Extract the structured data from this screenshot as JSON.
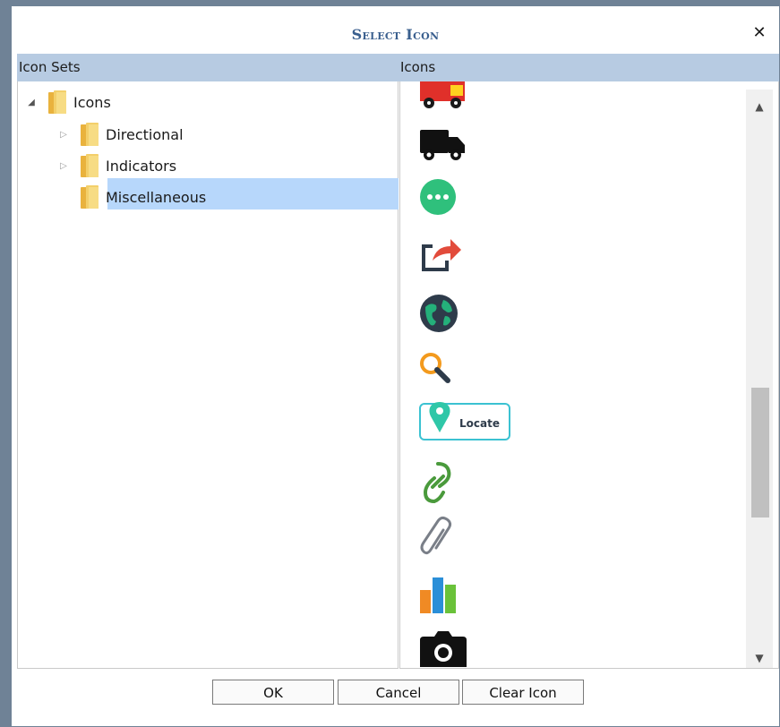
{
  "dialog": {
    "title": "Select Icon",
    "close_glyph": "✕"
  },
  "columns": {
    "left": "Icon Sets",
    "right": "Icons"
  },
  "tree": {
    "root": {
      "label": "Icons",
      "expanded": true
    },
    "children": [
      {
        "label": "Directional",
        "expanded": false
      },
      {
        "label": "Indicators",
        "expanded": false
      },
      {
        "label": "Miscellaneous",
        "selected": true
      }
    ]
  },
  "icons": [
    {
      "name": "fire-truck-icon"
    },
    {
      "name": "truck-icon"
    },
    {
      "name": "more-chat-icon"
    },
    {
      "name": "share-icon"
    },
    {
      "name": "globe-icon"
    },
    {
      "name": "search-icon"
    },
    {
      "name": "locate-icon",
      "label": "Locate"
    },
    {
      "name": "link-icon"
    },
    {
      "name": "paperclip-icon"
    },
    {
      "name": "bar-chart-icon"
    },
    {
      "name": "camera-icon"
    }
  ],
  "buttons": {
    "ok": "OK",
    "cancel": "Cancel",
    "clear": "Clear Icon"
  },
  "colors": {
    "header_bg": "#b7cbe2",
    "selection": "#b7d7fb",
    "title": "#3a5f8e"
  }
}
